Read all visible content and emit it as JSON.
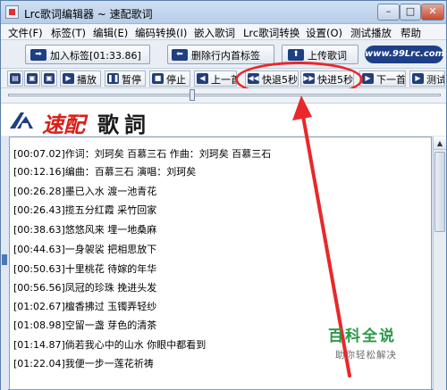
{
  "window": {
    "title": "Lrc歌词编辑器 ~ 速配歌词",
    "controls": {
      "minimize": "–",
      "maximize": "□",
      "close": "✕"
    }
  },
  "menu": [
    "文件(F)",
    "标签(T)",
    "编辑(E)",
    "编码转换(I)",
    "嵌入歌词",
    "Lrc歌词转换",
    "设置(O)",
    "测试播放",
    "帮助"
  ],
  "toolbar1": {
    "add_tag": "加入标签[01:33.86]",
    "delete_tag": "删除行内首标签",
    "upload": "上传歌词",
    "site_logo": "www.99Lrc.com"
  },
  "toolbar2": {
    "play": "播放",
    "pause": "暂停",
    "stop": "停止",
    "prev": "上一首",
    "rewind": "快退5秒",
    "forward": "快进5秒",
    "next": "下一首",
    "test": "测试"
  },
  "brand": {
    "red": "速配",
    "black": "歌詞"
  },
  "lyrics": [
    "[00:07.02]作词：刘珂矣 百慕三石 作曲：刘珂矣 百慕三石",
    "[00:12.16]编曲：百慕三石 演唱：刘珂矣",
    "[00:26.28]墨已入水 渡一池青花",
    "[00:26.43]揽五分红霞 采竹回家",
    "[00:38.63]悠悠风来 埋一地桑麻",
    "[00:44.63]一身袈裟 把相思放下",
    "[00:50.63]十里桃花 待嫁的年华",
    "[00:56.56]凤冠的珍珠 挽进头发",
    "[01:02.67]檀香拂过 玉镯弄轻纱",
    "[01:08.98]空留一盏 芽色的清茶",
    "[01:14.87]倘若我心中的山水 你眼中都看到",
    "[01:22.04]我便一步一莲花祈祷"
  ],
  "watermark": {
    "logo": "百科全说",
    "sub": "助你轻松解决"
  },
  "colors": {
    "accent": "#1e3f82",
    "brand_red": "#d8201a",
    "highlight": "#e8282a",
    "watermark": "#2a9a47"
  }
}
